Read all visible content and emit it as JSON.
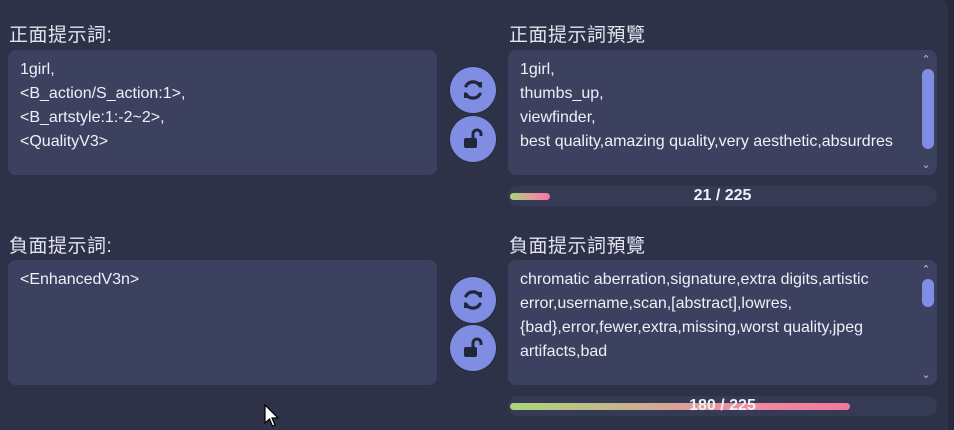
{
  "positive": {
    "title": "正面提示詞:",
    "value": "1girl,\n<B_action/S_action:1>,\n<B_artstyle:1:-2~2>,\n<QualityV3>",
    "preview_title": "正面提示詞預覽",
    "preview_text": "1girl,\nthumbs_up,\nviewfinder,\nbest quality,amazing quality,very aesthetic,absurdres",
    "token_count": "21 / 225",
    "token_fraction": 0.093
  },
  "negative": {
    "title": "負面提示詞:",
    "value": "<EnhancedV3n>",
    "preview_title": "負面提示詞預覽",
    "preview_text": "chromatic aberration,signature,extra digits,artistic error,username,scan,[abstract],lowres,{bad},error,fewer,extra,missing,worst quality,jpeg artifacts,bad",
    "token_count": "180 / 225",
    "token_fraction": 0.8
  },
  "icons": {
    "refresh": "refresh-icon",
    "unlock": "unlock-icon",
    "scroll_up": "chevron-up-icon",
    "scroll_down": "chevron-down-icon",
    "cursor": "mouse-cursor-icon"
  },
  "colors": {
    "background": "#2e3248",
    "box": "#3d4160",
    "accent": "#7f8de3",
    "progress_start": "#a8d878",
    "progress_end": "#f07a9a"
  }
}
